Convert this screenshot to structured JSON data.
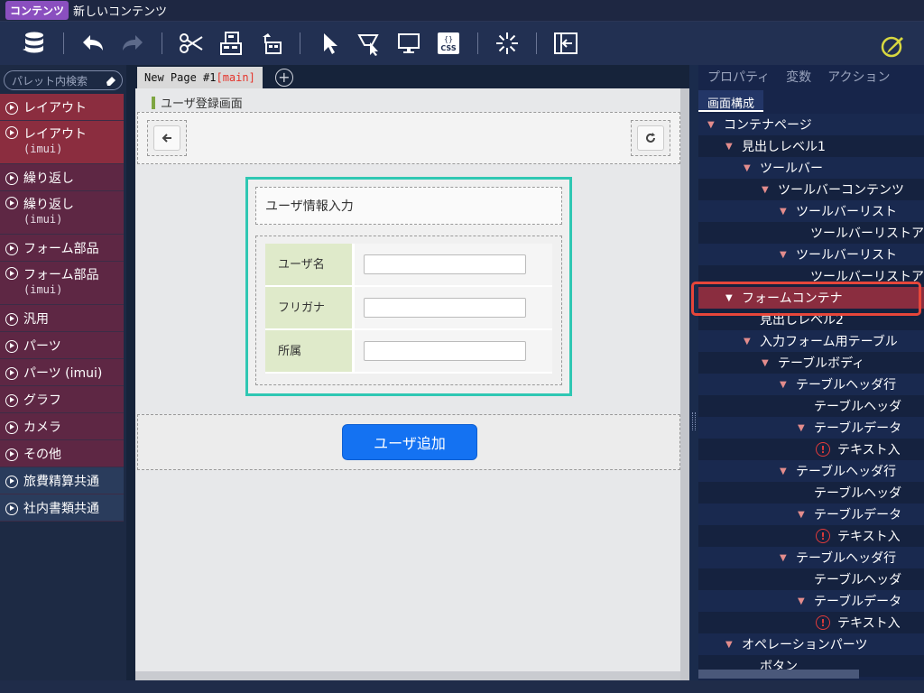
{
  "titlebar": {
    "badge": "コンテンツ",
    "title": "新しいコンテンツ"
  },
  "toolbar": {
    "icons": [
      "database-icon",
      "undo-icon",
      "redo-icon",
      "cut-icon",
      "copy-icon",
      "paste-icon",
      "cursor-icon",
      "select-area-icon",
      "preview-icon",
      "css-icon",
      "effect-icon",
      "insert-panel-icon",
      "edit-icon"
    ],
    "css_label": "CSS",
    "css_braces": "{}"
  },
  "palette": {
    "search_placeholder": "パレット内検索",
    "items": [
      {
        "label": "レイアウト",
        "sub": "",
        "style": "red"
      },
      {
        "label": "レイアウト",
        "sub": "(imui)",
        "style": "red"
      },
      {
        "label": "繰り返し",
        "sub": "",
        "style": "maroon"
      },
      {
        "label": "繰り返し",
        "sub": "(imui)",
        "style": "maroon"
      },
      {
        "label": "フォーム部品",
        "sub": "",
        "style": "maroon"
      },
      {
        "label": "フォーム部品",
        "sub": "(imui)",
        "style": "maroon"
      },
      {
        "label": "汎用",
        "sub": "",
        "style": "maroon"
      },
      {
        "label": "パーツ",
        "sub": "",
        "style": "maroon"
      },
      {
        "label": "パーツ (imui)",
        "sub": "",
        "style": "maroon"
      },
      {
        "label": "グラフ",
        "sub": "",
        "style": "maroon"
      },
      {
        "label": "カメラ",
        "sub": "",
        "style": "maroon"
      },
      {
        "label": "その他",
        "sub": "",
        "style": "maroon"
      },
      {
        "label": "旅費精算共通",
        "sub": "",
        "style": "navy"
      },
      {
        "label": "社内書類共通",
        "sub": "",
        "style": "navy"
      }
    ]
  },
  "editor": {
    "tab_name": "New Page #1",
    "tab_suffix": "[main]",
    "page_label": "ユーザ登録画面",
    "form_title": "ユーザ情報入力",
    "fields": [
      {
        "label": "ユーザ名",
        "value": ""
      },
      {
        "label": "フリガナ",
        "value": ""
      },
      {
        "label": "所属",
        "value": ""
      }
    ],
    "submit_label": "ユーザ追加"
  },
  "right_panel": {
    "tabs": [
      "プロパティ",
      "変数",
      "アクション"
    ],
    "active_subtab": "画面構成",
    "tree": [
      {
        "label": "コンテナページ",
        "indent": 0,
        "arrow": true,
        "warn": false,
        "selected": false
      },
      {
        "label": "見出しレベル1",
        "indent": 1,
        "arrow": true,
        "warn": false,
        "selected": false
      },
      {
        "label": "ツールバー",
        "indent": 2,
        "arrow": true,
        "warn": false,
        "selected": false
      },
      {
        "label": "ツールバーコンテンツ",
        "indent": 3,
        "arrow": true,
        "warn": false,
        "selected": false
      },
      {
        "label": "ツールバーリスト",
        "indent": 4,
        "arrow": true,
        "warn": false,
        "selected": false
      },
      {
        "label": "ツールバーリストア",
        "indent": 5,
        "arrow": false,
        "warn": false,
        "selected": false
      },
      {
        "label": "ツールバーリスト",
        "indent": 4,
        "arrow": true,
        "warn": false,
        "selected": false
      },
      {
        "label": "ツールバーリストア",
        "indent": 5,
        "arrow": false,
        "warn": false,
        "selected": false
      },
      {
        "label": "フォームコンテナ",
        "indent": 1,
        "arrow": true,
        "warn": false,
        "selected": true
      },
      {
        "label": "見出しレベル2",
        "indent": 2,
        "arrow": false,
        "warn": false,
        "selected": false
      },
      {
        "label": "入力フォーム用テーブル",
        "indent": 2,
        "arrow": true,
        "warn": false,
        "selected": false
      },
      {
        "label": "テーブルボディ",
        "indent": 3,
        "arrow": true,
        "warn": false,
        "selected": false
      },
      {
        "label": "テーブルヘッダ行",
        "indent": 4,
        "arrow": true,
        "warn": false,
        "selected": false
      },
      {
        "label": "テーブルヘッダ",
        "indent": 5,
        "arrow": false,
        "warn": false,
        "selected": false
      },
      {
        "label": "テーブルデータ",
        "indent": 5,
        "arrow": true,
        "warn": false,
        "selected": false
      },
      {
        "label": "テキスト入",
        "indent": 6,
        "arrow": false,
        "warn": true,
        "selected": false
      },
      {
        "label": "テーブルヘッダ行",
        "indent": 4,
        "arrow": true,
        "warn": false,
        "selected": false
      },
      {
        "label": "テーブルヘッダ",
        "indent": 5,
        "arrow": false,
        "warn": false,
        "selected": false
      },
      {
        "label": "テーブルデータ",
        "indent": 5,
        "arrow": true,
        "warn": false,
        "selected": false
      },
      {
        "label": "テキスト入",
        "indent": 6,
        "arrow": false,
        "warn": true,
        "selected": false
      },
      {
        "label": "テーブルヘッダ行",
        "indent": 4,
        "arrow": true,
        "warn": false,
        "selected": false
      },
      {
        "label": "テーブルヘッダ",
        "indent": 5,
        "arrow": false,
        "warn": false,
        "selected": false
      },
      {
        "label": "テーブルデータ",
        "indent": 5,
        "arrow": true,
        "warn": false,
        "selected": false
      },
      {
        "label": "テキスト入",
        "indent": 6,
        "arrow": false,
        "warn": true,
        "selected": false
      },
      {
        "label": "オペレーションパーツ",
        "indent": 1,
        "arrow": true,
        "warn": false,
        "selected": false
      },
      {
        "label": "ボタン",
        "indent": 2,
        "arrow": false,
        "warn": false,
        "selected": false
      }
    ]
  },
  "colors": {
    "selected_node": "#8a2d3f",
    "form_container_border": "#2fc7b3",
    "primary_button": "#1472f2",
    "highlight_outline": "#e6463a"
  }
}
